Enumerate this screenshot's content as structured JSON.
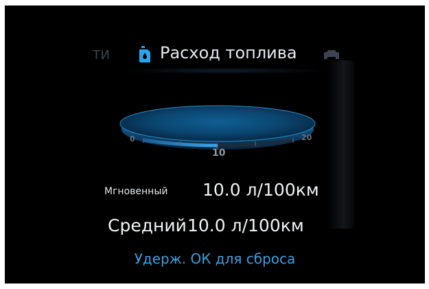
{
  "header": {
    "prev_tab_fragment": "ТИ",
    "title": "Расход топлива",
    "left_icon": "fuel-canister-icon",
    "right_icon": "car-icon"
  },
  "gauge": {
    "scale_min": "0",
    "scale_max": "20",
    "current_label": "10",
    "current_value": 10,
    "min_value": 0,
    "max_value": 20,
    "fill_fraction": 0.5
  },
  "instant": {
    "label": "Мгновенный",
    "value": "10.0 л/100км"
  },
  "average": {
    "label": "Средний",
    "value": "10.0 л/100км"
  },
  "hint": "Удерж. ОК для сброса",
  "colors": {
    "background": "#000000",
    "accent": "#3d9fe0",
    "text": "#f2f4f6",
    "dim": "#3b4350"
  }
}
